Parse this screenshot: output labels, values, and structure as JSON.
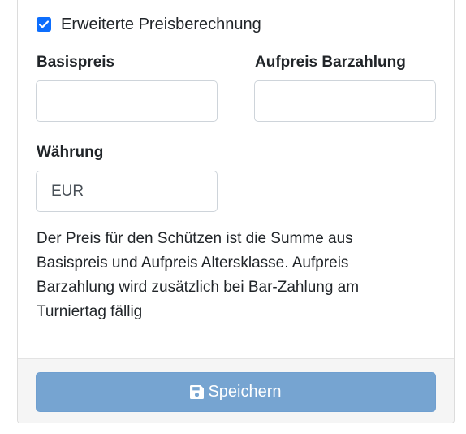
{
  "form": {
    "extended_pricing": {
      "label": "Erweiterte Preisberechnung",
      "checked": true
    },
    "base_price": {
      "label": "Basispreis",
      "value": ""
    },
    "cash_surcharge": {
      "label": "Aufpreis Barzahlung",
      "value": ""
    },
    "currency": {
      "label": "Währung",
      "value": "EUR"
    },
    "help_text": "Der Preis für den Schützen ist die Summe aus Basispreis und Aufpreis Altersklasse. Aufpreis Barzahlung wird zusätzlich bei Bar-Zahlung am Turniertag fällig"
  },
  "footer": {
    "save_label": "Speichern",
    "save_icon": "floppy-disk-icon"
  },
  "colors": {
    "checkbox": "#0d6efd",
    "save_button": "#76a4d1",
    "footer_bg": "#f5f5f5"
  }
}
